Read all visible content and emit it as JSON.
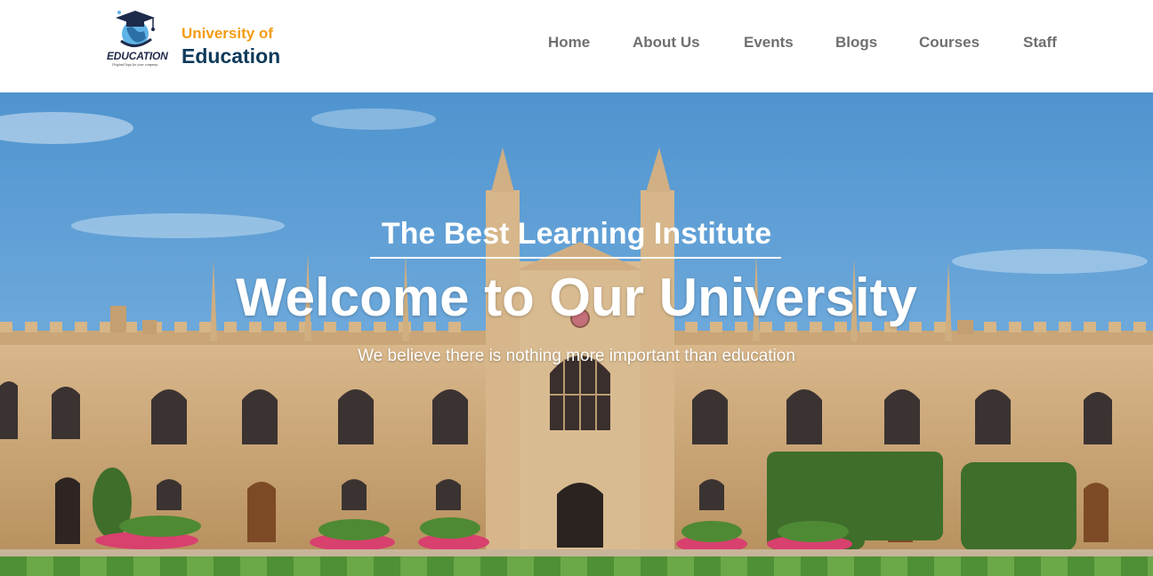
{
  "brand": {
    "logo_word": "EDUCATION",
    "logo_tagline": "Original logo for your company",
    "name_top": "University of",
    "name_bottom": "Education",
    "accent_color": "#f39c12",
    "dark_color": "#0f3a5a"
  },
  "nav": {
    "items": [
      {
        "label": "Home"
      },
      {
        "label": "About Us"
      },
      {
        "label": "Events"
      },
      {
        "label": "Blogs"
      },
      {
        "label": "Courses"
      },
      {
        "label": "Staff"
      }
    ]
  },
  "hero": {
    "subtitle": "The Best Learning Institute",
    "title": "Welcome to Our University",
    "text": "We believe there is nothing more important than education"
  }
}
